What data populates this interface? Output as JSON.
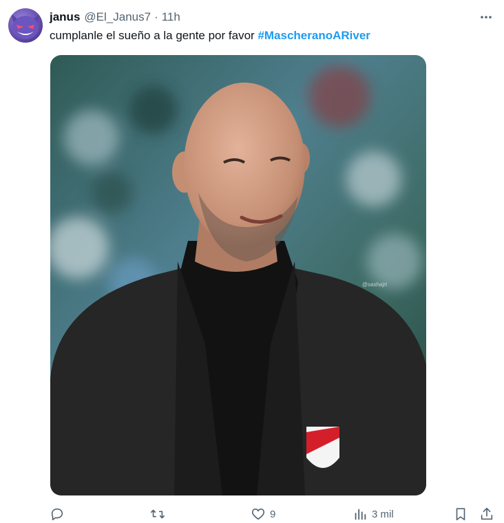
{
  "tweet": {
    "author_name": "janus",
    "handle": "@El_Janus7",
    "separator": "·",
    "timestamp": "11h",
    "text": "cumplanle el sueño a la gente por favor",
    "hashtag": "#MascheranoARiver",
    "media_watermark": "@sashajrt"
  },
  "actions": {
    "reply_count": "",
    "retweet_count": "",
    "like_count": "9",
    "views_count": "3 mil"
  },
  "icons": {
    "more": "more-horizontal-icon",
    "reply": "reply-icon",
    "retweet": "retweet-icon",
    "like": "heart-icon",
    "views": "bar-chart-icon",
    "bookmark": "bookmark-icon",
    "share": "share-icon"
  },
  "colors": {
    "text": "#0f1419",
    "secondary": "#536471",
    "link": "#1d9bf0"
  }
}
